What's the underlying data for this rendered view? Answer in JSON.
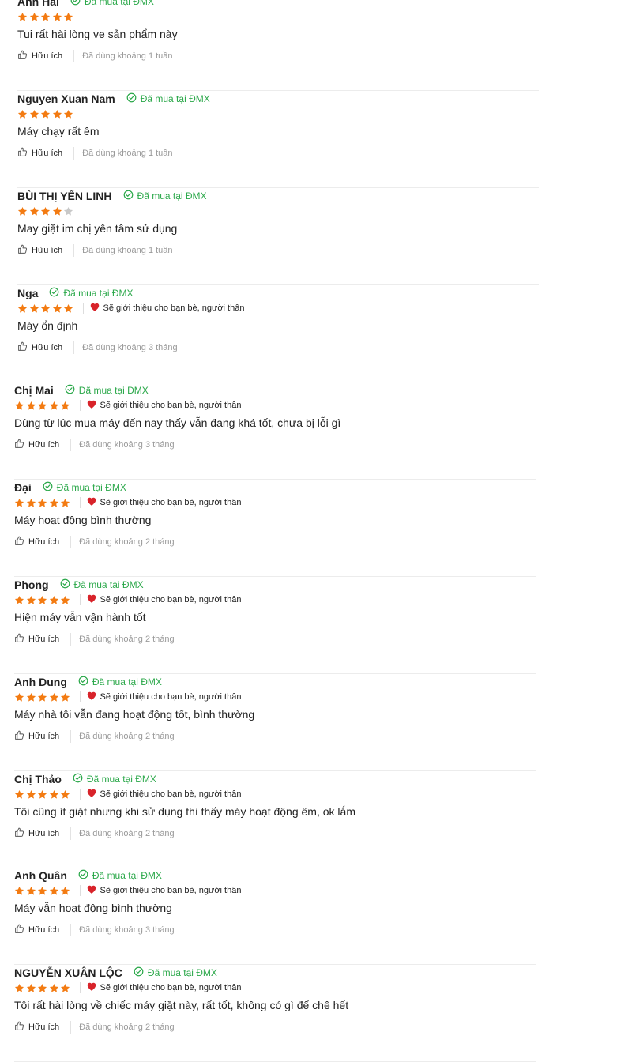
{
  "verified_label": "Đã mua tại ĐMX",
  "recommend_label": "Sẽ giới thiệu cho bạn bè, người thân",
  "helpful_label": "Hữu ích",
  "colors": {
    "star": "#f37b12",
    "star_empty": "#c8c8c8",
    "verified": "#2ba84a",
    "heart": "#d8232a"
  },
  "reviews": [
    {
      "name": "Anh Hai",
      "stars": 5,
      "recommend": false,
      "content": "Tui rất hài lòng ve sản phẩm này",
      "used": "Đã dùng khoảng 1 tuần"
    },
    {
      "name": "Nguyen Xuan Nam",
      "stars": 5,
      "recommend": false,
      "content": "Máy chạy rất êm",
      "used": "Đã dùng khoảng 1 tuần"
    },
    {
      "name": "BÙI THỊ YẾN LINH",
      "stars": 4,
      "recommend": false,
      "content": "May giặt im chị yên tâm sử dụng",
      "used": "Đã dùng khoảng 1 tuần"
    },
    {
      "name": "Nga",
      "stars": 5,
      "recommend": true,
      "content": "Máy ổn định",
      "used": "Đã dùng khoảng 3 tháng"
    },
    {
      "name": "Chị Mai",
      "stars": 5,
      "recommend": true,
      "content": "Dùng từ lúc mua máy đến nay thấy vẫn đang khá tốt, chưa bị lỗi gì",
      "used": "Đã dùng khoảng 3 tháng"
    },
    {
      "name": "Đại",
      "stars": 5,
      "recommend": true,
      "content": "Máy hoạt động bình thường",
      "used": "Đã dùng khoảng 2 tháng"
    },
    {
      "name": "Phong",
      "stars": 5,
      "recommend": true,
      "content": "Hiện máy vẫn vận hành tốt",
      "used": "Đã dùng khoảng 2 tháng"
    },
    {
      "name": "Anh Dung",
      "stars": 5,
      "recommend": true,
      "content": "Máy nhà tôi vẫn đang hoạt động tốt, bình thường",
      "used": "Đã dùng khoảng 2 tháng"
    },
    {
      "name": "Chị Thảo",
      "stars": 5,
      "recommend": true,
      "content": "Tôi cũng ít giặt nhưng khi sử dụng thì thấy máy hoạt động êm, ok lắm",
      "used": "Đã dùng khoảng 2 tháng"
    },
    {
      "name": "Anh Quân",
      "stars": 5,
      "recommend": true,
      "content": "Máy vẫn hoạt động bình thường",
      "used": "Đã dùng khoảng 3 tháng"
    },
    {
      "name": "NGUYỄN XUÂN LỘC",
      "stars": 5,
      "recommend": true,
      "content": "Tôi rất hài lòng về chiếc máy giặt này, rất tốt, không có gì để chê hết",
      "used": "Đã dùng khoảng 2 tháng"
    }
  ]
}
